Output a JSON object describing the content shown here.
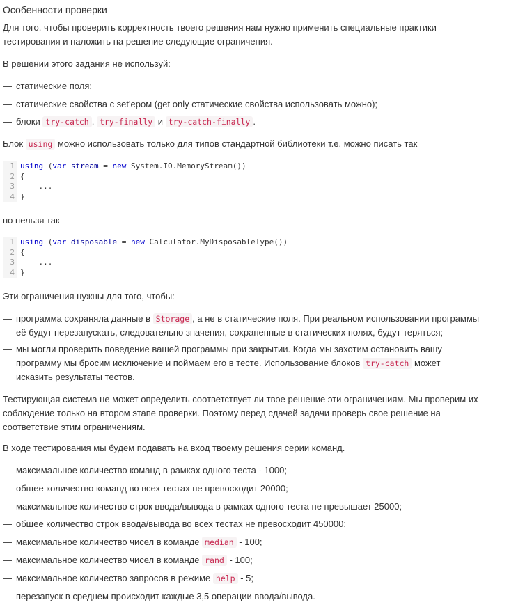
{
  "title": "Особенности проверки",
  "intro": {
    "line1": "Для того, чтобы проверить корректность твоего решения нам нужно применить специальные практики",
    "line2": "тестирования и наложить на решение следующие ограничения."
  },
  "restrictions_heading": "В решении этого задания не используй:",
  "restrictions": {
    "item1": "статические поля;",
    "item2": "статические свойства с set'ером (get only статические свойства использовать можно);",
    "item3_prefix": "блоки",
    "code_try_catch": "try-catch",
    "code_try_finally": "try-finally",
    "and": "и",
    "code_try_catch_finally": "try-catch-finally",
    "item3_suffix": "."
  },
  "dash": "—",
  "comma": ",",
  "using_note": {
    "prefix": "Блок",
    "code": "using",
    "suffix": "можно использовать только для типов стандартной библиотеки т.е. можно писать так"
  },
  "code1": {
    "line_numbers": [
      "1",
      "2",
      "3",
      "4"
    ],
    "kw_using": "using",
    "paren_open": "(",
    "kw_var": "var",
    "var_name": "stream",
    "eq": "=",
    "kw_new": "new",
    "type": "System.IO.MemoryStream()",
    "paren_close": ")",
    "brace_open": "{",
    "ellipsis": "...",
    "brace_close": "}"
  },
  "but_not": "но нельзя так",
  "code2": {
    "line_numbers": [
      "1",
      "2",
      "3",
      "4"
    ],
    "kw_using": "using",
    "paren_open": "(",
    "kw_var": "var",
    "var_name": "disposable",
    "eq": "=",
    "kw_new": "new",
    "type": "Calculator.MyDisposableType()",
    "paren_close": ")",
    "brace_open": "{",
    "ellipsis": "...",
    "brace_close": "}"
  },
  "reasons_heading": "Эти ограничения нужны для того, чтобы:",
  "reasons": {
    "r1_prefix": "программа сохраняла данные в",
    "r1_code": "Storage",
    "r1_l1_suffix": ", а не в статические поля. При реальном использовании программы",
    "r1_l2": "её будут перезапускать, следовательно значения, сохраненные в статических полях, будут теряться;",
    "r2_l1": "мы могли проверить поведение вашей программы при закрытии. Когда мы захотим остановить вашу",
    "r2_l2_prefix": "программу мы бросим исключение и поймаем его в тесте. Использование блоков",
    "r2_code": "try-catch",
    "r2_l2_suffix": "может",
    "r2_l3": "исказить результаты тестов."
  },
  "note": {
    "line1": "Тестирующая система не может определить соответствует ли твое решение эти ограничениям. Мы проверим их",
    "line2": "соблюдение только на втором этапе проверки. Поэтому перед сдачей задачи проверь свое решение на",
    "line3": "соответствие этим ограничениям."
  },
  "limits_heading": "В ходе тестирования мы будем подавать на вход твоему решения серии команд.",
  "limits": {
    "l1": "максимальное количество команд в рамках одного теста - 1000;",
    "l2": "общее количество команд во всех тестах не превосходит 20000;",
    "l3": "максимальное количество строк ввода/вывода в рамках одного теста не превышает 25000;",
    "l4": "общее количество строк ввода/вывода во всех тестах не превосходит 450000;",
    "l5_prefix": "максимальное количество чисел в команде",
    "l5_code": "median",
    "l5_suffix": "- 100;",
    "l6_prefix": "максимальное количество чисел в команде",
    "l6_code": "rand",
    "l6_suffix": "- 100;",
    "l7_prefix": "максимальное количество запросов в режиме",
    "l7_code": "help",
    "l7_suffix": "- 5;",
    "l8": "перезапуск в среднем происходит каждые 3,5 операции ввода/вывода."
  }
}
